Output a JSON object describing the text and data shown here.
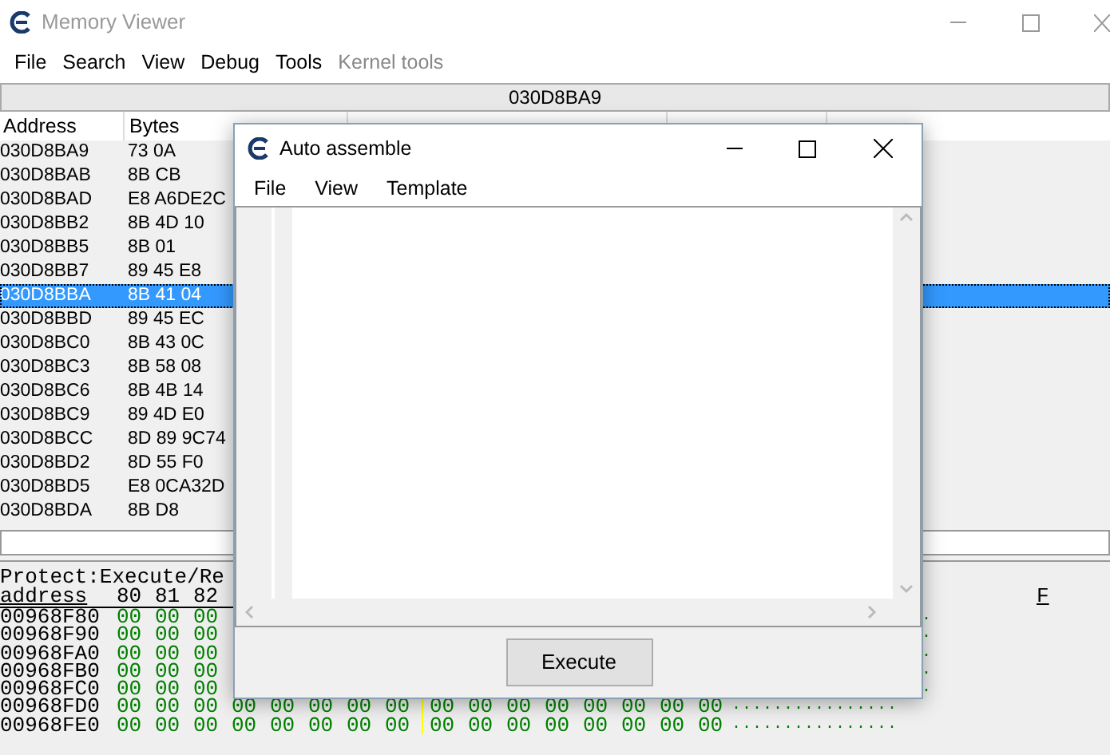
{
  "window": {
    "title": "Memory Viewer"
  },
  "menu": [
    {
      "label": "File",
      "disabled": false
    },
    {
      "label": "Search",
      "disabled": false
    },
    {
      "label": "View",
      "disabled": false
    },
    {
      "label": "Debug",
      "disabled": false
    },
    {
      "label": "Tools",
      "disabled": false
    },
    {
      "label": "Kernel tools",
      "disabled": true
    }
  ],
  "address_bar": "030D8BA9",
  "disassembly": {
    "columns": [
      "Address",
      "Bytes"
    ],
    "rows": [
      {
        "address": "030D8BA9",
        "bytes": "73 0A",
        "selected": false
      },
      {
        "address": "030D8BAB",
        "bytes": "8B CB",
        "selected": false
      },
      {
        "address": "030D8BAD",
        "bytes": "E8 A6DE2C",
        "selected": false
      },
      {
        "address": "030D8BB2",
        "bytes": "8B 4D 10",
        "selected": false
      },
      {
        "address": "030D8BB5",
        "bytes": "8B 01",
        "selected": false
      },
      {
        "address": "030D8BB7",
        "bytes": "89 45 E8",
        "selected": false
      },
      {
        "address": "030D8BBA",
        "bytes": "8B 41 04",
        "selected": true
      },
      {
        "address": "030D8BBD",
        "bytes": "89 45 EC",
        "selected": false
      },
      {
        "address": "030D8BC0",
        "bytes": "8B 43 0C",
        "selected": false
      },
      {
        "address": "030D8BC3",
        "bytes": "8B 58 08",
        "selected": false
      },
      {
        "address": "030D8BC6",
        "bytes": "8B 4B 14",
        "selected": false
      },
      {
        "address": "030D8BC9",
        "bytes": "89 4D E0",
        "selected": false
      },
      {
        "address": "030D8BCC",
        "bytes": "8D 89 9C74",
        "selected": false
      },
      {
        "address": "030D8BD2",
        "bytes": "8D 55 F0",
        "selected": false
      },
      {
        "address": "030D8BD5",
        "bytes": "E8 0CA32D",
        "selected": false
      },
      {
        "address": "030D8BDA",
        "bytes": "8B D8",
        "selected": false
      }
    ]
  },
  "hex_view": {
    "protect": "Protect:Execute/Re",
    "header": [
      "address",
      "80",
      "81",
      "82"
    ],
    "ascii_header": "F",
    "rows": [
      {
        "address": "00968F80",
        "bytes": [
          "00",
          "00",
          "00"
        ],
        "ascii": "."
      },
      {
        "address": "00968F90",
        "bytes": [
          "00",
          "00",
          "00"
        ],
        "ascii": "."
      },
      {
        "address": "00968FA0",
        "bytes": [
          "00",
          "00",
          "00"
        ],
        "ascii": "."
      },
      {
        "address": "00968FB0",
        "bytes": [
          "00",
          "00",
          "00"
        ],
        "ascii": "."
      },
      {
        "address": "00968FC0",
        "bytes": [
          "00",
          "00",
          "00"
        ],
        "ascii": "."
      },
      {
        "address": "00968FD0",
        "bytes": [
          "00",
          "00",
          "00",
          "00",
          "00",
          "00",
          "00",
          "00",
          "00",
          "00",
          "00",
          "00",
          "00",
          "00",
          "00",
          "00"
        ],
        "ascii": "................"
      },
      {
        "address": "00968FE0",
        "bytes": [
          "00",
          "00",
          "00",
          "00",
          "00",
          "00",
          "00",
          "00",
          "00",
          "00",
          "00",
          "00",
          "00",
          "00",
          "00",
          "00"
        ],
        "ascii": "................"
      }
    ]
  },
  "dialog": {
    "title": "Auto assemble",
    "menu": [
      "File",
      "View",
      "Template"
    ],
    "button": "Execute"
  }
}
